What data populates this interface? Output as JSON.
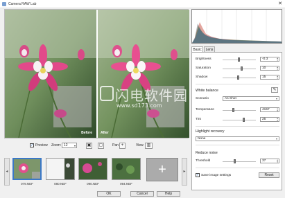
{
  "window": {
    "title": "Camera RAW Lab"
  },
  "preview": {
    "before_label": "Before",
    "after_label": "After"
  },
  "controls": {
    "preview_label": "Preview",
    "preview_checked": true,
    "zoom_label": "Zoom:",
    "zoom_value": "12",
    "pan_label": "Pan",
    "view_label": "View"
  },
  "thumbnails": [
    {
      "label": "079.NEF",
      "selected": true
    },
    {
      "label": "080.NEF",
      "selected": false
    },
    {
      "label": "090.NEF",
      "selected": false
    },
    {
      "label": "094.NEF",
      "selected": false
    }
  ],
  "buttons": {
    "ok": "OK",
    "cancel": "Cancel",
    "help": "Help"
  },
  "tabs": [
    "Basic",
    "Lens"
  ],
  "active_tab": "Basic",
  "adjustments": [
    {
      "label": "Brightness",
      "value": "-0.3",
      "level": 0.48
    },
    {
      "label": "Saturation",
      "value": "10",
      "level": 0.55
    },
    {
      "label": "Shadow",
      "value": "15",
      "level": 0.45
    }
  ],
  "white_balance": {
    "title": "White balance",
    "scenario_label": "Scenario",
    "scenario_value": "As Shot",
    "temperature_label": "Temperature",
    "temperature_value": "4157",
    "temperature_level": 0.3,
    "tint_label": "Tint",
    "tint_value": "25",
    "tint_level": 0.62
  },
  "highlight_recovery": {
    "title": "Highlight recovery",
    "value": "None"
  },
  "reduce_noise": {
    "title": "Reduce noise",
    "threshold_label": "Threshold",
    "threshold_value": "37",
    "threshold_level": 0.35
  },
  "save_settings": {
    "label": "Save image settings",
    "checked": true
  },
  "reset_label": "Reset",
  "watermark": {
    "text": "闪电软件园",
    "url": "www.sd173.com"
  },
  "colors": {
    "accent": "#3b78c7",
    "panel_bg": "#f0f0f0"
  }
}
